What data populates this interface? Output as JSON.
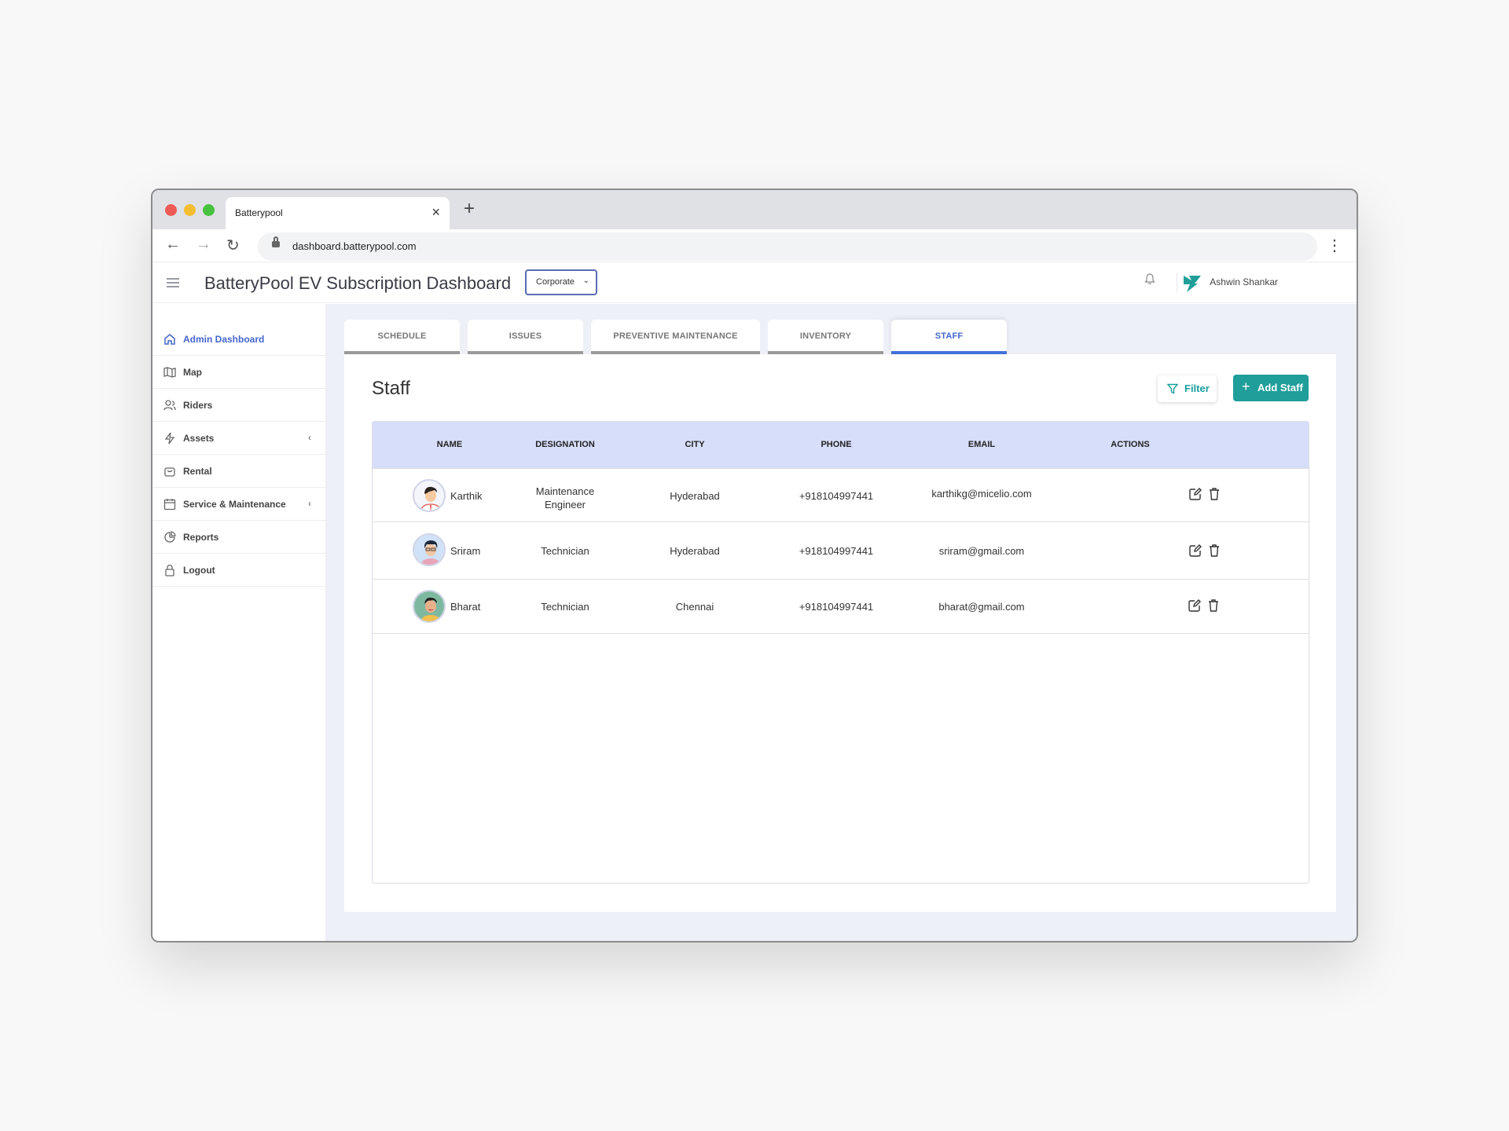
{
  "browser": {
    "tab_title": "Batterypool",
    "tab_close": "×",
    "new_tab": "+",
    "url": "dashboard.batterypool.com",
    "back": "←",
    "forward": "→",
    "reload": "↻",
    "menu": "⋮"
  },
  "header": {
    "title": "BatteryPool EV Subscription Dashboard",
    "org_select": "Corporate",
    "user_name": "Ashwin Shankar"
  },
  "sidebar": {
    "items": [
      {
        "label": "Admin Dashboard",
        "icon": "home-icon"
      },
      {
        "label": "Map",
        "icon": "map-icon"
      },
      {
        "label": "Riders",
        "icon": "users-icon"
      },
      {
        "label": "Assets",
        "icon": "bolt-icon",
        "arrow": "‹"
      },
      {
        "label": "Rental",
        "icon": "bag-icon"
      },
      {
        "label": "Service & Maintenance",
        "icon": "calendar-icon",
        "arrow": "‹"
      },
      {
        "label": "Reports",
        "icon": "pie-chart-icon"
      },
      {
        "label": "Logout",
        "icon": "lock-icon"
      }
    ]
  },
  "tabs": [
    "SCHEDULE",
    "ISSUES",
    "PREVENTIVE MAINTENANCE",
    "INVENTORY",
    "STAFF"
  ],
  "active_tab": "STAFF",
  "panel": {
    "title": "Staff",
    "filter_label": "Filter",
    "add_label": "Add Staff",
    "add_plus": "+"
  },
  "table": {
    "headers": [
      "NAME",
      "DESIGNATION",
      "CITY",
      "PHONE",
      "EMAIL",
      "ACTIONS"
    ],
    "rows": [
      {
        "name": "Karthik",
        "designation_line1": "Maintenance",
        "designation_line2": "Engineer",
        "city": "Hyderabad",
        "phone": "+918104997441",
        "email": "karthikg@micelio.com"
      },
      {
        "name": "Sriram",
        "designation_line1": "Technician",
        "designation_line2": "",
        "city": "Hyderabad",
        "phone": "+918104997441",
        "email": "sriram@gmail.com"
      },
      {
        "name": "Bharat",
        "designation_line1": "Technician",
        "designation_line2": "",
        "city": "Chennai",
        "phone": "+918104997441",
        "email": "bharat@gmail.com"
      }
    ]
  },
  "colors": {
    "accent": "#4466cc",
    "teal": "#1f9e9a",
    "table_header": "#d6def9",
    "main_bg": "#eef0f7"
  }
}
